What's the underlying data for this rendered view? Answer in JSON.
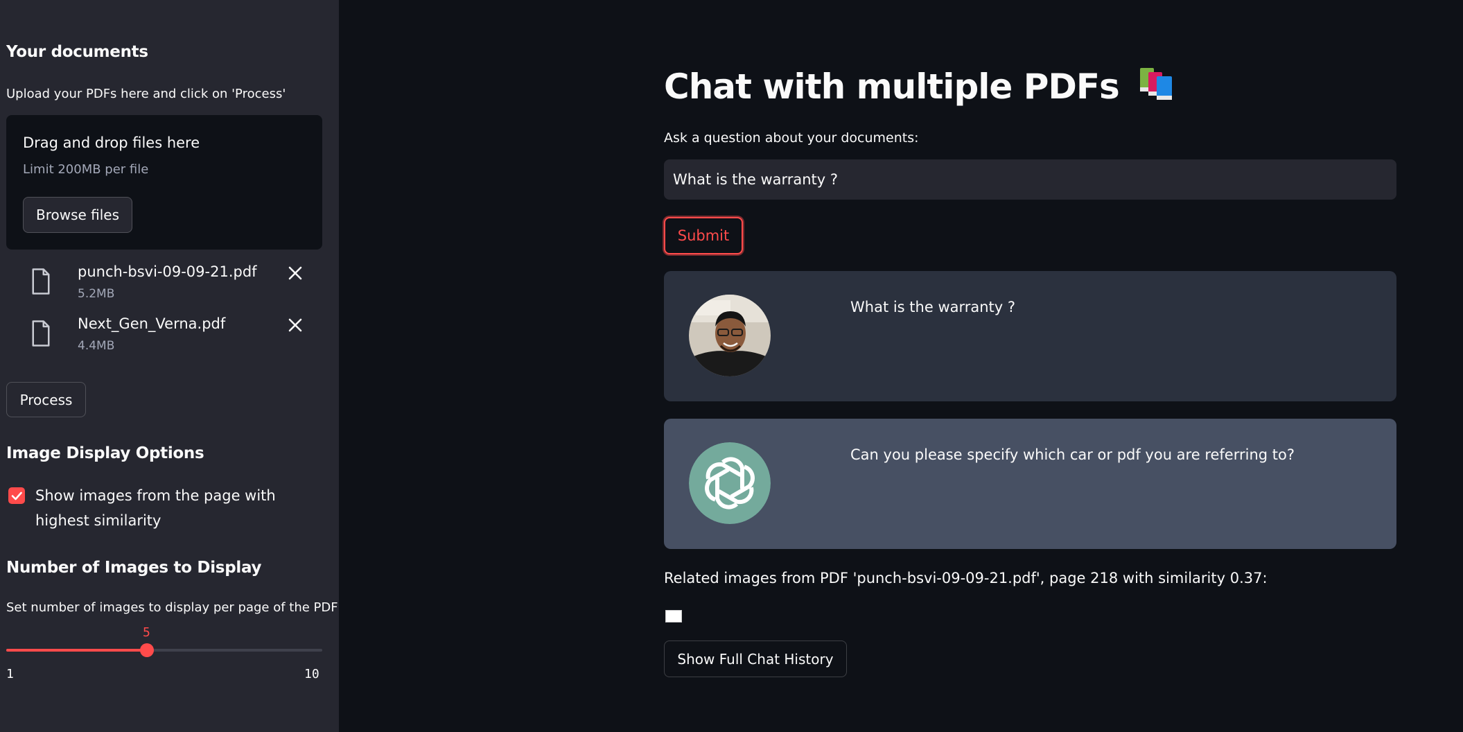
{
  "sidebar": {
    "documents_heading": "Your documents",
    "upload_hint": "Upload your PDFs here and click on 'Process'",
    "dropzone": {
      "title": "Drag and drop files here",
      "limit": "Limit 200MB per file",
      "browse_label": "Browse files"
    },
    "files": [
      {
        "name": "punch-bsvi-09-09-21.pdf",
        "size": "5.2MB"
      },
      {
        "name": "Next_Gen_Verna.pdf",
        "size": "4.4MB"
      }
    ],
    "process_label": "Process",
    "image_options_heading": "Image Display Options",
    "show_images_label": "Show images from the page with highest similarity",
    "show_images_checked": true,
    "num_images_heading": "Number of Images to Display",
    "num_images_hint": "Set number of images to display per page of the PDF",
    "slider": {
      "value": 5,
      "value_label": "5",
      "min": 1,
      "max": 10,
      "min_label": "1",
      "max_label": "10"
    }
  },
  "main": {
    "title": "Chat with multiple PDFs",
    "title_icon": "books-icon",
    "question_label": "Ask a question about your documents:",
    "question_value": "What is the warranty ?",
    "submit_label": "Submit",
    "messages": [
      {
        "role": "user",
        "text": "What is the warranty ?",
        "avatar": "user-photo-avatar"
      },
      {
        "role": "bot",
        "text": "Can you please specify which car or pdf you are referring to?",
        "avatar": "openai-logo-icon"
      }
    ],
    "related_text": "Related images from PDF 'punch-bsvi-09-09-21.pdf', page 218 with similarity 0.37:",
    "history_label": "Show Full Chat History"
  },
  "colors": {
    "accent": "#ff4b4b",
    "background": "#0e1117",
    "sidebar": "#262730",
    "user_message": "#2b313e",
    "bot_message": "#475063",
    "bot_avatar": "#74aa9c"
  }
}
